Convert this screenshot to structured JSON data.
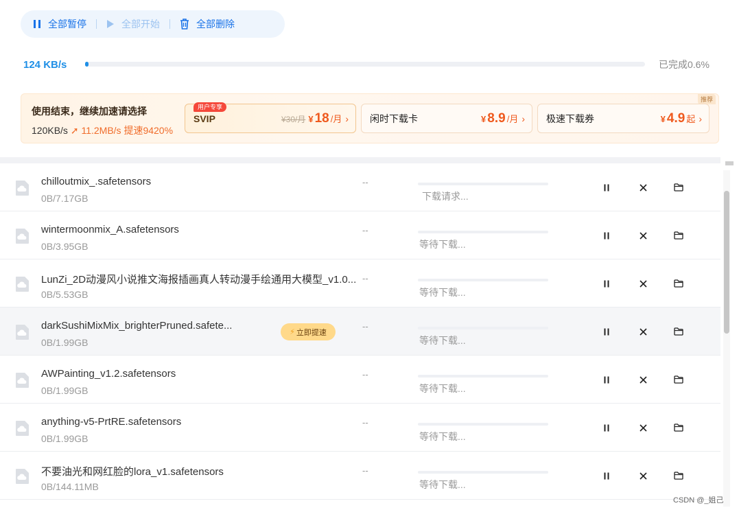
{
  "toolbar": {
    "pause_all": "全部暂停",
    "start_all": "全部开始",
    "delete_all": "全部删除"
  },
  "progress": {
    "speed": "124 KB/s",
    "percent": 0.6,
    "completed_label": "已完成0.6%"
  },
  "promo": {
    "title": "使用结束，继续加速请选择",
    "from_speed": "120KB/s",
    "boost_text": "11.2MB/s 提速9420%",
    "corner_tag": "推荐",
    "offers": [
      {
        "badge": "用户专享",
        "name": "SVIP",
        "old_price": "¥30/月",
        "currency": "¥",
        "price": "18",
        "unit": "/月"
      },
      {
        "badge": "",
        "name": "闲时下载卡",
        "old_price": "",
        "currency": "¥",
        "price": "8.9",
        "unit": "/月"
      },
      {
        "badge": "",
        "name": "极速下载券",
        "old_price": "",
        "currency": "¥",
        "price": "4.9",
        "unit": "起"
      }
    ]
  },
  "downloads": [
    {
      "name": "chilloutmix_.safetensors",
      "size": "0B/7.17GB",
      "speed": "--",
      "status": "下载请求..."
    },
    {
      "name": "wintermoonmix_A.safetensors",
      "size": "0B/3.95GB",
      "speed": "--",
      "status": "等待下载..."
    },
    {
      "name": "LunZi_2D动漫风小说推文海报插画真人转动漫手绘通用大模型_v1.0...",
      "size": "0B/5.53GB",
      "speed": "--",
      "status": "等待下载..."
    },
    {
      "name": "darkSushiMixMix_brighterPruned.safete...",
      "size": "0B/1.99GB",
      "speed": "--",
      "status": "等待下载...",
      "boost_label": "立即提速"
    },
    {
      "name": "AWPainting_v1.2.safetensors",
      "size": "0B/1.99GB",
      "speed": "--",
      "status": "等待下载..."
    },
    {
      "name": "anything-v5-PrtRE.safetensors",
      "size": "0B/1.99GB",
      "speed": "--",
      "status": "等待下载..."
    },
    {
      "name": "不要油光和网红脸的lora_v1.safetensors",
      "size": "0B/144.11MB",
      "speed": "--",
      "status": "等待下载..."
    }
  ],
  "watermark": "CSDN @_姐己",
  "colors": {
    "accent": "#1f8fe6",
    "promo_orange": "#ef5a1e",
    "boost_yellow": "#ffd98a"
  }
}
